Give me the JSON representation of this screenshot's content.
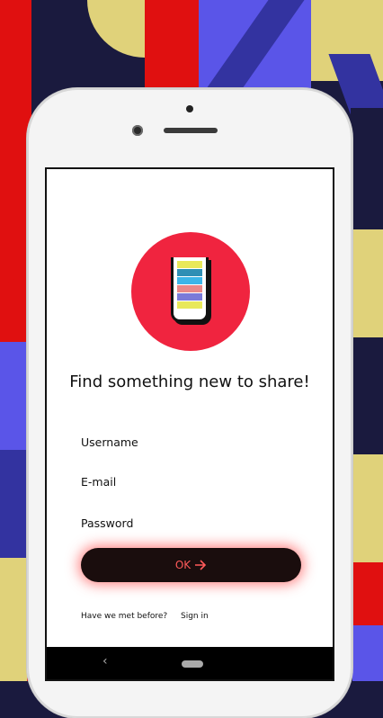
{
  "background": {
    "colors": [
      "#e0d27a",
      "#e01010",
      "#1a1a3e",
      "#5a55e8",
      "#3333a0"
    ]
  },
  "logo": {
    "name": "stacked-cup-logo",
    "stripe_colors": [
      "#e8e85a",
      "#2f8fb5",
      "#3bb5e8",
      "#e88888",
      "#7a7ad8",
      "#e8e85a"
    ]
  },
  "headline": "Find something new to share!",
  "form": {
    "username_label": "Username",
    "email_label": "E-mail",
    "password_label": "Password",
    "ok_label": "OK"
  },
  "footer": {
    "prompt": "Have we met before?",
    "signin_link": "Sign in"
  },
  "nav": {
    "back_icon": "back-chevron-icon",
    "home_icon": "home-pill-icon"
  }
}
